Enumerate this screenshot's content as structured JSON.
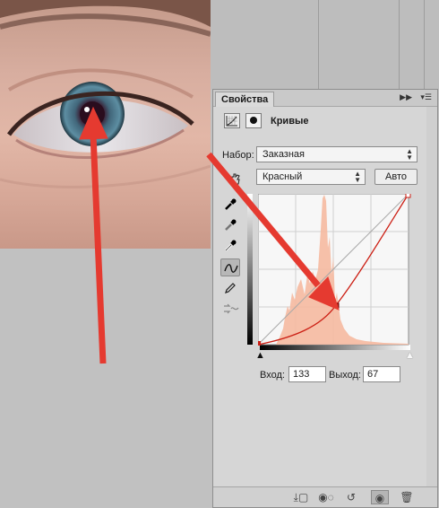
{
  "panel": {
    "tab_label": "Свойства",
    "collapse_icon": "double-chevron-right",
    "menu_icon": "panel-menu",
    "adjustment_title": "Кривые"
  },
  "preset": {
    "label": "Набор:",
    "value": "Заказная"
  },
  "channel": {
    "value": "Красный"
  },
  "auto_button": "Авто",
  "curve": {
    "input_label": "Вход:",
    "input_value": "133",
    "output_label": "Выход:",
    "output_value": "67"
  },
  "tools": [
    "on-image-adjust-icon",
    "black-point-eyedropper-icon",
    "gray-point-eyedropper-icon",
    "white-point-eyedropper-icon",
    "curve-point-tool-icon",
    "pencil-icon",
    "smooth-icon"
  ],
  "footer_icons": [
    "clip-to-layer-icon",
    "view-previous-icon",
    "reset-icon",
    "visibility-eye-icon",
    "trash-icon"
  ],
  "colors": {
    "annotation_arrow": "#e53a30",
    "curve_line": "#cc1f14",
    "histogram": "#f5b9a0"
  }
}
